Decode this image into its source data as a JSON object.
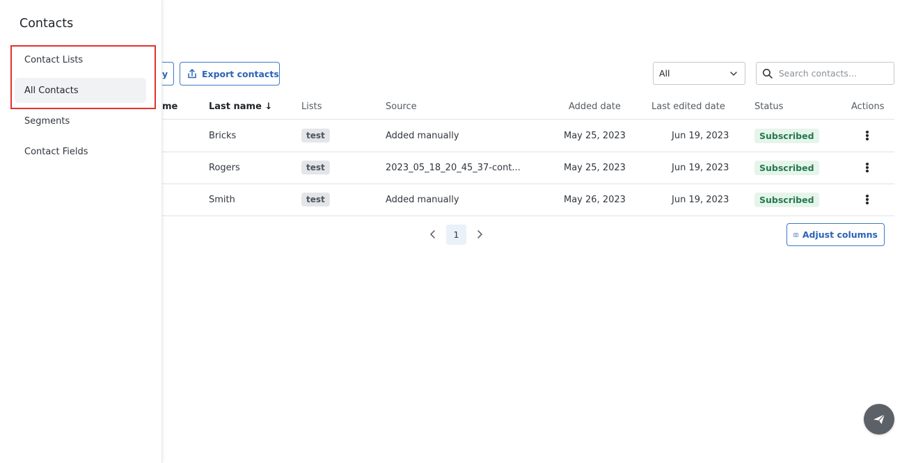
{
  "drawer": {
    "title": "Contacts",
    "items": [
      {
        "label": "Contact Lists",
        "active": false
      },
      {
        "label": "All Contacts",
        "active": true
      },
      {
        "label": "Segments",
        "active": false
      },
      {
        "label": "Contact Fields",
        "active": false
      }
    ]
  },
  "toolbar": {
    "partial_button_label": "y",
    "export_label": "Export contacts",
    "filter_value": "All",
    "search_placeholder": "Search contacts..."
  },
  "table": {
    "columns": {
      "first_name_partial": "me",
      "last_name": "Last name",
      "sort_indicator": "↓",
      "lists": "Lists",
      "source": "Source",
      "added_date": "Added date",
      "last_edited_date": "Last edited date",
      "status": "Status",
      "actions": "Actions"
    },
    "rows": [
      {
        "last_name": "Bricks",
        "list": "test",
        "source": "Added manually",
        "added": "May 25, 2023",
        "edited": "Jun 19, 2023",
        "status": "Subscribed"
      },
      {
        "last_name": "Rogers",
        "list": "test",
        "source": "2023_05_18_20_45_37-cont...",
        "added": "May 25, 2023",
        "edited": "Jun 19, 2023",
        "status": "Subscribed"
      },
      {
        "last_name": "Smith",
        "list": "test",
        "source": "Added manually",
        "added": "May 26, 2023",
        "edited": "Jun 19, 2023",
        "status": "Subscribed"
      }
    ]
  },
  "pagination": {
    "current_page": "1",
    "prev_icon": "chevron-left-icon",
    "next_icon": "chevron-right-icon"
  },
  "adjust_columns_label": "Adjust columns",
  "colors": {
    "accent": "#2a63b8",
    "highlight": "#e0312b",
    "status_green": "#237a4b"
  },
  "icons": {
    "export": "upload-icon",
    "search": "search-icon",
    "columns": "columns-icon",
    "fab": "paper-plane-icon"
  }
}
